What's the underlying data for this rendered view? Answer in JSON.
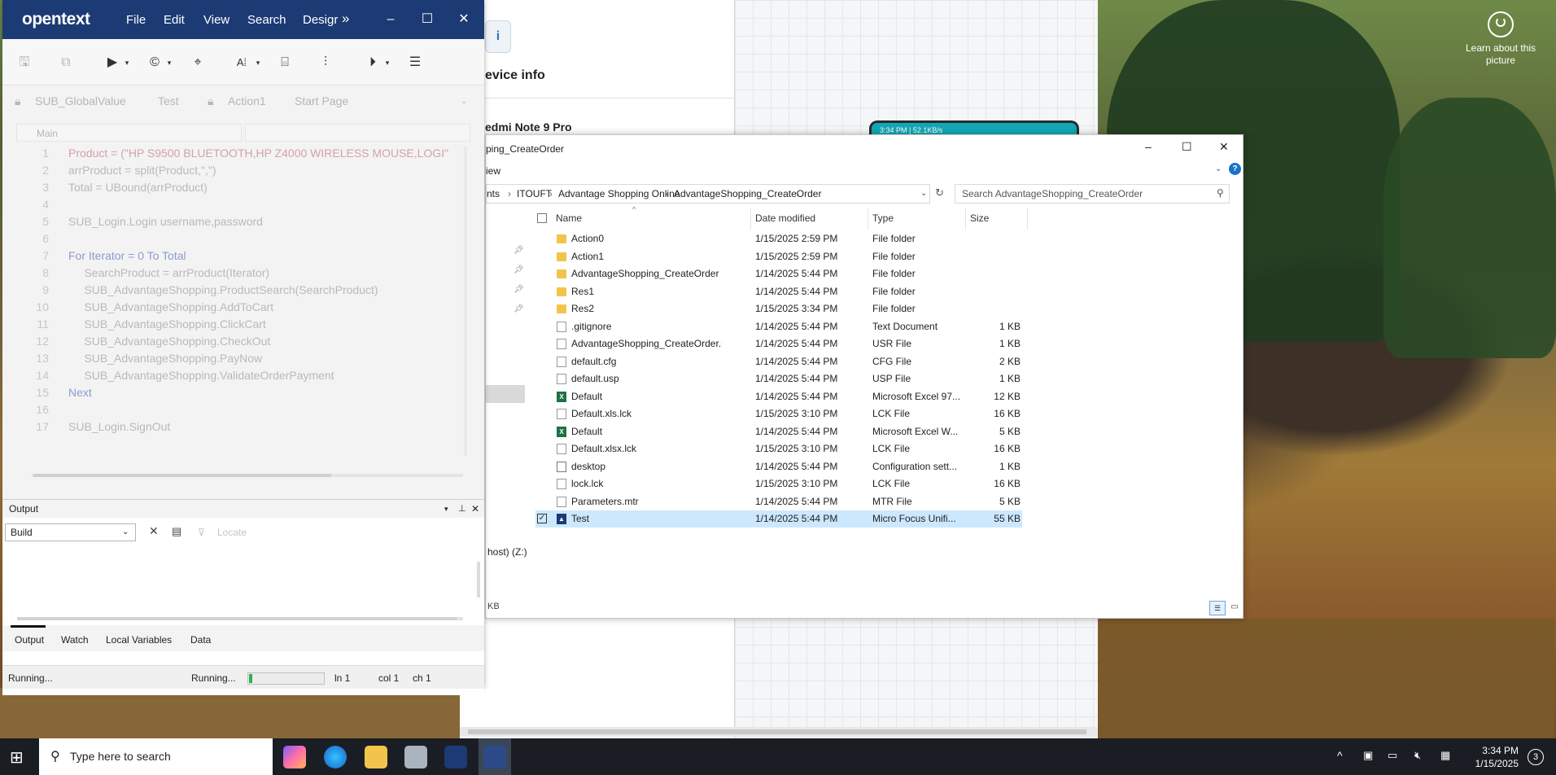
{
  "desktop": {
    "spotlight_label": "Learn about this picture"
  },
  "background_app": {
    "device_info_title": "evice info",
    "device_icon": "i",
    "device_name": "edmi Note 9 Pro",
    "phone_status": "3:34 PM | 52.1KB/s",
    "drive_label": "host) (Z:)",
    "kb_label": "KB"
  },
  "uft": {
    "logo": "opentext",
    "menu": [
      "File",
      "Edit",
      "View",
      "Search",
      "Desigr"
    ],
    "more_icon": "»",
    "window_controls": {
      "minimize": "–",
      "maximize": "☐",
      "close": "✕"
    },
    "tabs": [
      "SUB_GlobalValue",
      "Test",
      "Action1",
      "Start Page"
    ],
    "combo_main": "Main",
    "code_lines": [
      {
        "n": "1",
        "text": "Product = (\"HP S9500 BLUETOOTH,HP Z4000 WIRELESS MOUSE,LOGI\""
      },
      {
        "n": "2",
        "text": "arrProduct = split(Product,\",\")"
      },
      {
        "n": "3",
        "text": "Total = UBound(arrProduct)"
      },
      {
        "n": "4",
        "text": ""
      },
      {
        "n": "5",
        "text": "SUB_Login.Login username,password"
      },
      {
        "n": "6",
        "text": ""
      },
      {
        "n": "7",
        "text": "For Iterator = 0 To Total"
      },
      {
        "n": "8",
        "text": "     SearchProduct = arrProduct(Iterator)"
      },
      {
        "n": "9",
        "text": "     SUB_AdvantageShopping.ProductSearch(SearchProduct)"
      },
      {
        "n": "10",
        "text": "     SUB_AdvantageShopping.AddToCart"
      },
      {
        "n": "11",
        "text": "     SUB_AdvantageShopping.ClickCart"
      },
      {
        "n": "12",
        "text": "     SUB_AdvantageShopping.CheckOut"
      },
      {
        "n": "13",
        "text": "     SUB_AdvantageShopping.PayNow"
      },
      {
        "n": "14",
        "text": "     SUB_AdvantageShopping.ValidateOrderPayment"
      },
      {
        "n": "15",
        "text": "Next"
      },
      {
        "n": "16",
        "text": ""
      },
      {
        "n": "17",
        "text": "SUB_Login.SignOut"
      }
    ],
    "output": {
      "title": "Output",
      "build_value": "Build",
      "locate_label": "Locate",
      "bottom_tabs": [
        "Output",
        "Watch",
        "Local Variables",
        "Data"
      ]
    },
    "status": {
      "left": "Running...",
      "progress_label": "Running...",
      "progress_fraction": 0.04,
      "ln": "ln 1",
      "col": "col 1",
      "ch": "ch 1"
    }
  },
  "explorer": {
    "title": "ping_CreateOrder",
    "view_menu": "iew",
    "window_controls": {
      "minimize": "–",
      "maximize": "☐",
      "close": "✕"
    },
    "breadcrumb": [
      "nts",
      "ITOUFT",
      "Advantage Shopping Online",
      "AdvantageShopping_CreateOrder"
    ],
    "search_placeholder": "Search AdvantageShopping_CreateOrder",
    "columns": {
      "name": "Name",
      "date": "Date modified",
      "type": "Type",
      "size": "Size"
    },
    "files": [
      {
        "name": "Action0",
        "date": "1/15/2025 2:59 PM",
        "type": "File folder",
        "size": "",
        "icon": "folder"
      },
      {
        "name": "Action1",
        "date": "1/15/2025 2:59 PM",
        "type": "File folder",
        "size": "",
        "icon": "folder"
      },
      {
        "name": "AdvantageShopping_CreateOrder",
        "date": "1/14/2025 5:44 PM",
        "type": "File folder",
        "size": "",
        "icon": "folder"
      },
      {
        "name": "Res1",
        "date": "1/14/2025 5:44 PM",
        "type": "File folder",
        "size": "",
        "icon": "folder"
      },
      {
        "name": "Res2",
        "date": "1/15/2025 3:34 PM",
        "type": "File folder",
        "size": "",
        "icon": "folder"
      },
      {
        "name": ".gitignore",
        "date": "1/14/2025 5:44 PM",
        "type": "Text Document",
        "size": "1 KB",
        "icon": "doc"
      },
      {
        "name": "AdvantageShopping_CreateOrder.usr",
        "date": "1/14/2025 5:44 PM",
        "type": "USR File",
        "size": "1 KB",
        "icon": "doc"
      },
      {
        "name": "default.cfg",
        "date": "1/14/2025 5:44 PM",
        "type": "CFG File",
        "size": "2 KB",
        "icon": "doc"
      },
      {
        "name": "default.usp",
        "date": "1/14/2025 5:44 PM",
        "type": "USP File",
        "size": "1 KB",
        "icon": "doc"
      },
      {
        "name": "Default",
        "date": "1/14/2025 5:44 PM",
        "type": "Microsoft Excel 97...",
        "size": "12 KB",
        "icon": "xls"
      },
      {
        "name": "Default.xls.lck",
        "date": "1/15/2025 3:10 PM",
        "type": "LCK File",
        "size": "16 KB",
        "icon": "doc"
      },
      {
        "name": "Default",
        "date": "1/14/2025 5:44 PM",
        "type": "Microsoft Excel W...",
        "size": "5 KB",
        "icon": "xls"
      },
      {
        "name": "Default.xlsx.lck",
        "date": "1/15/2025 3:10 PM",
        "type": "LCK File",
        "size": "16 KB",
        "icon": "doc"
      },
      {
        "name": "desktop",
        "date": "1/14/2025 5:44 PM",
        "type": "Configuration sett...",
        "size": "1 KB",
        "icon": "cfg"
      },
      {
        "name": "lock.lck",
        "date": "1/15/2025 3:10 PM",
        "type": "LCK File",
        "size": "16 KB",
        "icon": "doc"
      },
      {
        "name": "Parameters.mtr",
        "date": "1/14/2025 5:44 PM",
        "type": "MTR File",
        "size": "5 KB",
        "icon": "doc"
      },
      {
        "name": "Test",
        "date": "1/14/2025 5:44 PM",
        "type": "Micro Focus Unifi...",
        "size": "55 KB",
        "icon": "test",
        "selected": true
      }
    ]
  },
  "taskbar": {
    "search_placeholder": "Type here to search",
    "time": "3:34 PM",
    "date": "1/15/2025",
    "notification_count": "3"
  }
}
